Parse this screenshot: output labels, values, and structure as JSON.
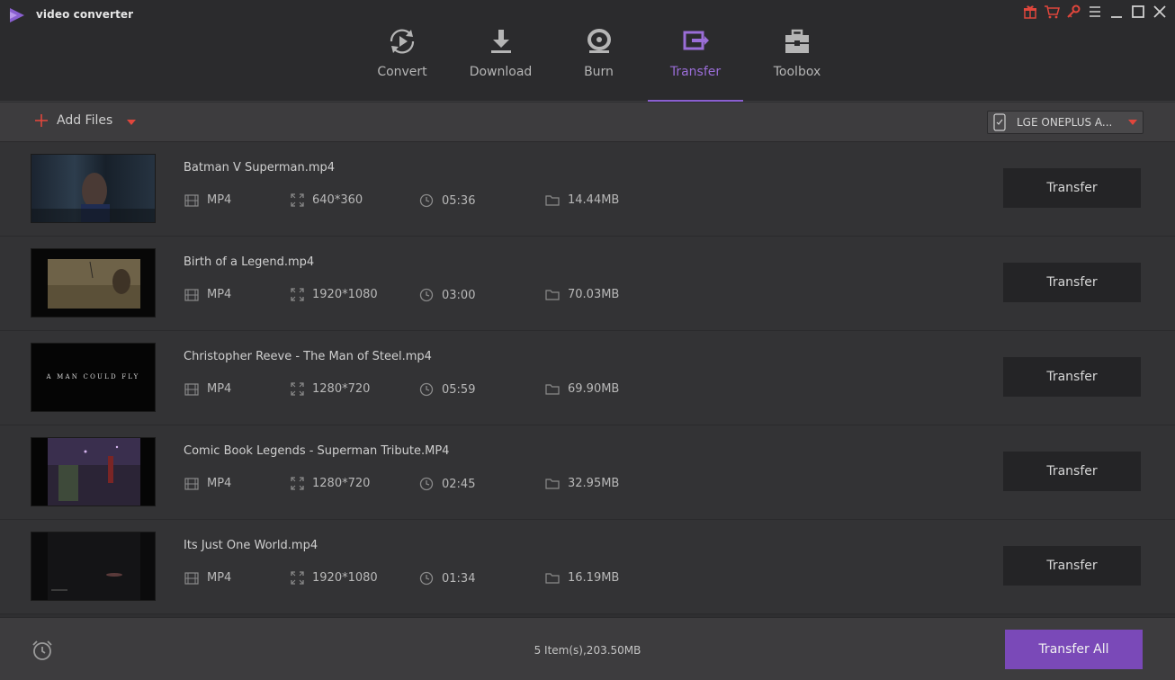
{
  "app": {
    "title": "video converter"
  },
  "tabs": [
    {
      "label": "Convert",
      "icon": "convert-icon",
      "active": false
    },
    {
      "label": "Download",
      "icon": "download-icon",
      "active": false
    },
    {
      "label": "Burn",
      "icon": "burn-icon",
      "active": false
    },
    {
      "label": "Transfer",
      "icon": "transfer-icon",
      "active": true
    },
    {
      "label": "Toolbox",
      "icon": "toolbox-icon",
      "active": false
    }
  ],
  "toolbar": {
    "add_files_label": "Add Files",
    "device_name": "LGE ONEPLUS A..."
  },
  "files": [
    {
      "name": "Batman V Superman.mp4",
      "format": "MP4",
      "resolution": "640*360",
      "duration": "05:36",
      "size": "14.44MB",
      "action": "Transfer"
    },
    {
      "name": "Birth of a Legend.mp4",
      "format": "MP4",
      "resolution": "1920*1080",
      "duration": "03:00",
      "size": "70.03MB",
      "action": "Transfer"
    },
    {
      "name": "Christopher Reeve - The Man of Steel.mp4",
      "format": "MP4",
      "resolution": "1280*720",
      "duration": "05:59",
      "size": "69.90MB",
      "action": "Transfer",
      "thumb_text": "A MAN COULD FLY"
    },
    {
      "name": "Comic Book Legends - Superman Tribute.MP4",
      "format": "MP4",
      "resolution": "1280*720",
      "duration": "02:45",
      "size": "32.95MB",
      "action": "Transfer"
    },
    {
      "name": "Its Just One World.mp4",
      "format": "MP4",
      "resolution": "1920*1080",
      "duration": "01:34",
      "size": "16.19MB",
      "action": "Transfer"
    }
  ],
  "footer": {
    "summary": "5 Item(s),203.50MB",
    "transfer_all_label": "Transfer All"
  },
  "colors": {
    "accent": "#8a5fd0",
    "accent_button": "#7a49b8",
    "header_bg": "#2b2b2d",
    "row_bg": "#333335",
    "red_icon": "#e0463c"
  }
}
